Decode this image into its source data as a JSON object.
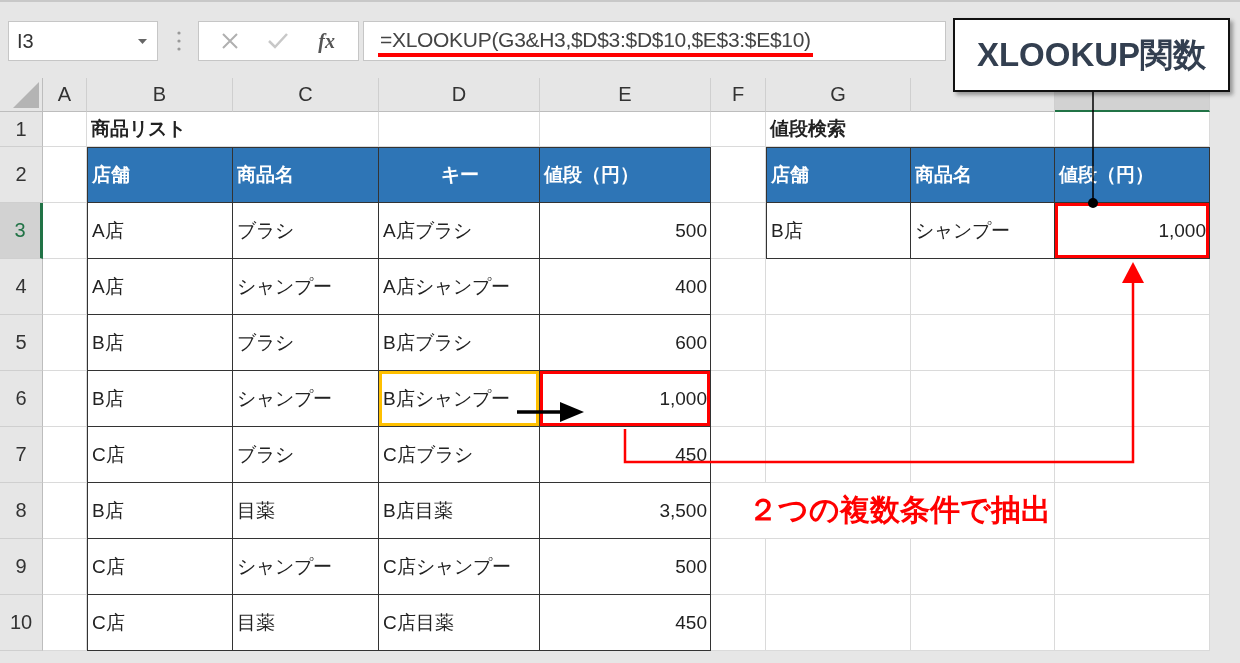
{
  "formula_bar": {
    "name_box": "I3",
    "function_label": "fx",
    "formula": "=XLOOKUP(G3&H3,$D$3:$D$10,$E$3:$E$10)"
  },
  "callout": {
    "text": "XLOOKUP関数"
  },
  "columns": [
    {
      "label": "A",
      "selected": false
    },
    {
      "label": "B",
      "selected": false
    },
    {
      "label": "C",
      "selected": false
    },
    {
      "label": "D",
      "selected": false
    },
    {
      "label": "E",
      "selected": false
    },
    {
      "label": "F",
      "selected": false
    },
    {
      "label": "G",
      "selected": false
    },
    {
      "selected": false
    },
    {
      "selected": true
    }
  ],
  "rows": [
    {
      "label": "1",
      "selected": false
    },
    {
      "label": "2",
      "selected": false
    },
    {
      "label": "3",
      "selected": true
    },
    {
      "label": "4",
      "selected": false
    },
    {
      "label": "5",
      "selected": false
    },
    {
      "label": "6",
      "selected": false
    },
    {
      "label": "7",
      "selected": false
    },
    {
      "label": "8",
      "selected": false
    },
    {
      "label": "9",
      "selected": false
    },
    {
      "label": "10",
      "selected": false
    }
  ],
  "product_list": {
    "title": "商品リスト",
    "headers": [
      "店舗",
      "商品名",
      "キー",
      "値段（円）"
    ],
    "rows": [
      {
        "cells": [
          "A店",
          "ブラシ",
          "A店ブラシ",
          "500"
        ],
        "matched": false
      },
      {
        "cells": [
          "A店",
          "シャンプー",
          "A店シャンプー",
          "400"
        ],
        "matched": false
      },
      {
        "cells": [
          "B店",
          "ブラシ",
          "B店ブラシ",
          "600"
        ],
        "matched": false
      },
      {
        "cells": [
          "B店",
          "シャンプー",
          "B店シャンプー",
          "1,000"
        ],
        "matched": true
      },
      {
        "cells": [
          "C店",
          "ブラシ",
          "C店ブラシ",
          "450"
        ],
        "matched": false
      },
      {
        "cells": [
          "B店",
          "目薬",
          "B店目薬",
          "3,500"
        ],
        "matched": false
      },
      {
        "cells": [
          "C店",
          "シャンプー",
          "C店シャンプー",
          "500"
        ],
        "matched": false
      },
      {
        "cells": [
          "C店",
          "目薬",
          "C店目薬",
          "450"
        ],
        "matched": false
      }
    ]
  },
  "price_search": {
    "title": "値段検索",
    "headers": [
      "店舗",
      "商品名",
      "値段（円）"
    ],
    "rows": [
      {
        "cells": [
          "B店",
          "シャンプー",
          "1,000"
        ],
        "matched": true
      }
    ]
  },
  "annotation": {
    "text": "２つの複数条件で抽出"
  }
}
